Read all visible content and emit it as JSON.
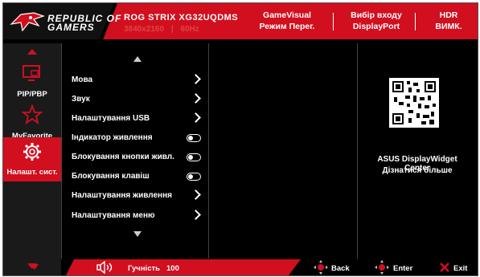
{
  "header": {
    "brand_line1": "REPUBLIC OF",
    "brand_line2": "GAMERS",
    "model": "ROG STRIX XG32UQDMS",
    "resolution": "3840x2160",
    "refresh": "60Hz",
    "separator": "|",
    "status": [
      {
        "line1": "GameVisual",
        "line2": "Режим Перег."
      },
      {
        "line1": "Вибір входу",
        "line2": "DisplayPort"
      },
      {
        "line1": "HDR",
        "line2": "ВИМК."
      }
    ]
  },
  "sidebar": {
    "items": [
      {
        "label": "PIP/PBP",
        "icon": "pip-icon"
      },
      {
        "label": "MyFavorite",
        "icon": "star-icon"
      },
      {
        "label": "Налашт. сист.",
        "icon": "gear-icon",
        "active": true
      }
    ]
  },
  "menu": {
    "items": [
      {
        "label": "Мова",
        "control": "chevron"
      },
      {
        "label": "Звук",
        "control": "chevron"
      },
      {
        "label": "Налаштування USB",
        "control": "chevron"
      },
      {
        "label": "Індикатор живлення",
        "control": "toggle",
        "state": "off"
      },
      {
        "label": "Блокування кнопки живл.",
        "control": "toggle",
        "state": "off"
      },
      {
        "label": "Блокування клавіш",
        "control": "toggle",
        "state": "off"
      },
      {
        "label": "Налаштування живлення",
        "control": "chevron"
      },
      {
        "label": "Налаштування меню",
        "control": "chevron"
      }
    ]
  },
  "promo": {
    "line1": "ASUS DisplayWidget Center",
    "line2": "Дізнатися більше"
  },
  "footer": {
    "volume_label": "Гучність",
    "volume_value": "100",
    "back": "Back",
    "enter": "Enter",
    "exit": "Exit"
  },
  "colors": {
    "accent": "#d10f1f",
    "background": "#000000"
  }
}
